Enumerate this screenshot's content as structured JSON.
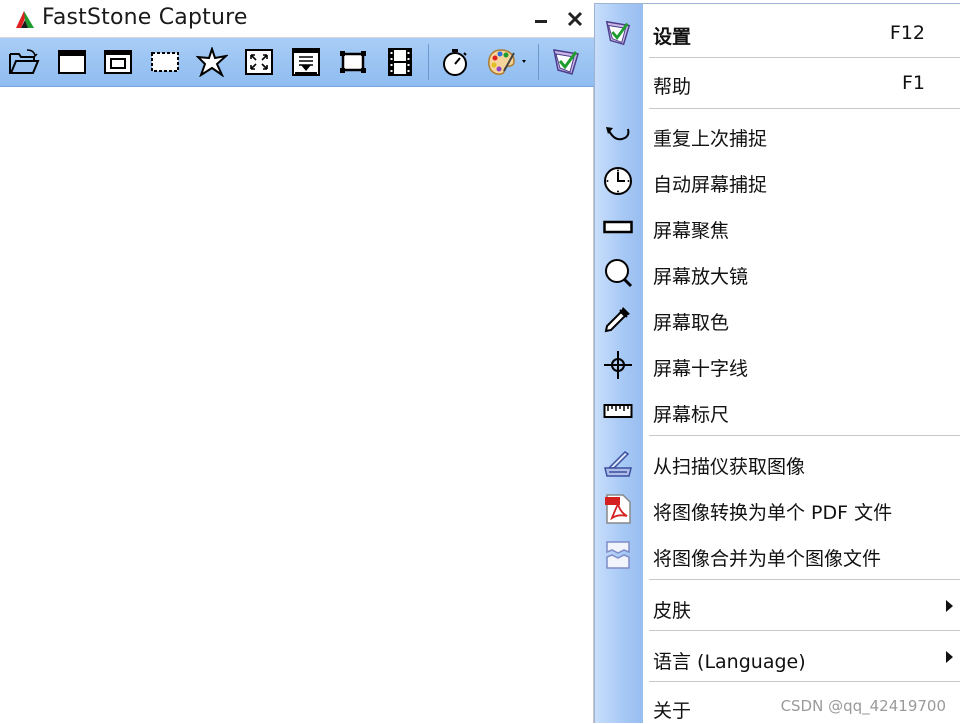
{
  "window": {
    "title": "FastStone Capture"
  },
  "toolbar": {
    "tools": [
      {
        "name": "open-icon"
      },
      {
        "name": "capture-window-icon"
      },
      {
        "name": "capture-object-icon"
      },
      {
        "name": "capture-rect-icon"
      },
      {
        "name": "capture-freehand-icon"
      },
      {
        "name": "capture-fullscreen-icon"
      },
      {
        "name": "capture-scrolling-icon"
      },
      {
        "name": "capture-fixed-icon"
      },
      {
        "name": "screen-recorder-icon"
      },
      {
        "name": "delay-timer-icon"
      },
      {
        "name": "output-palette-icon"
      },
      {
        "name": "settings-menu-icon"
      }
    ]
  },
  "menu": {
    "settings": {
      "label": "设置",
      "shortcut": "F12"
    },
    "help": {
      "label": "帮助",
      "shortcut": "F1"
    },
    "repeat_last": {
      "label": "重复上次捕捉"
    },
    "auto_capture": {
      "label": "自动屏幕捕捉"
    },
    "screen_focus": {
      "label": "屏幕聚焦"
    },
    "magnifier": {
      "label": "屏幕放大镜"
    },
    "color_picker": {
      "label": "屏幕取色"
    },
    "crosshair": {
      "label": "屏幕十字线"
    },
    "ruler": {
      "label": "屏幕标尺"
    },
    "scanner": {
      "label": "从扫描仪获取图像"
    },
    "to_pdf": {
      "label": "将图像转换为单个 PDF 文件"
    },
    "combine": {
      "label": "将图像合并为单个图像文件"
    },
    "skin": {
      "label": "皮肤"
    },
    "language": {
      "label": "语言 (Language)"
    },
    "about": {
      "label": "关于"
    }
  },
  "watermark": "CSDN @qq_42419700",
  "colors": {
    "toolbar": "#9ec5f3",
    "menu_gutter": "#a6c8f5",
    "logo_red": "#e02020",
    "logo_green": "#1e9c2e"
  }
}
